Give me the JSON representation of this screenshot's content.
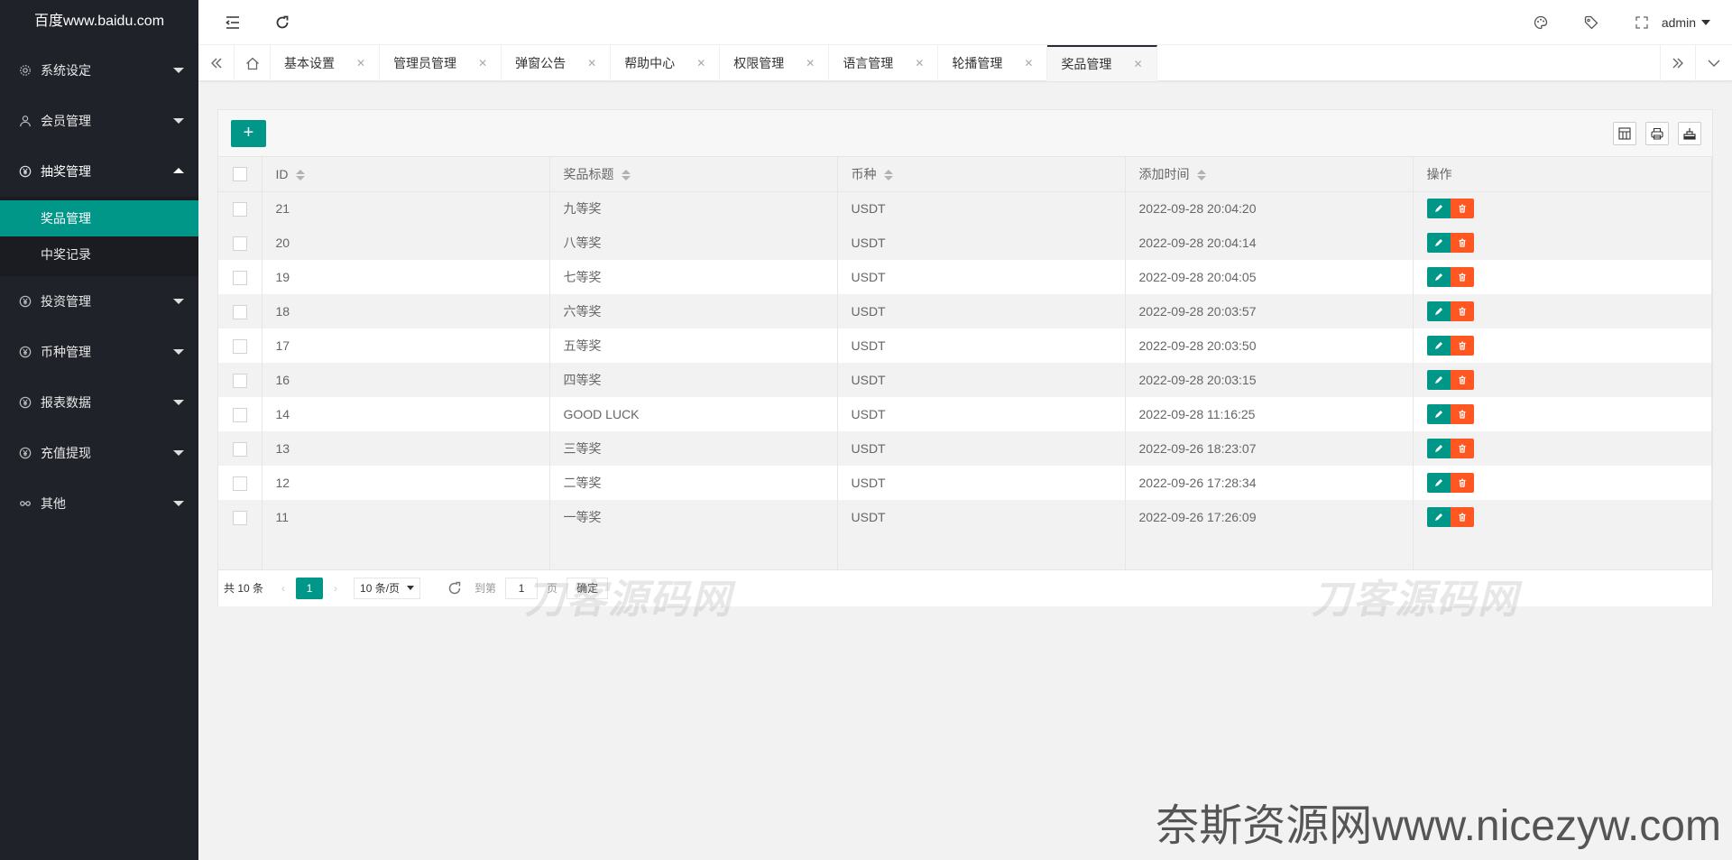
{
  "sidebar": {
    "logo": "百度www.baidu.com",
    "items": [
      {
        "label": "系统设定",
        "icon": "gear-icon"
      },
      {
        "label": "会员管理",
        "icon": "user-icon"
      },
      {
        "label": "抽奖管理",
        "icon": "yen-icon"
      },
      {
        "label": "投资管理",
        "icon": "yen-icon"
      },
      {
        "label": "币种管理",
        "icon": "yen-icon"
      },
      {
        "label": "报表数据",
        "icon": "yen-icon"
      },
      {
        "label": "充值提现",
        "icon": "yen-icon"
      },
      {
        "label": "其他",
        "icon": "link-icon"
      }
    ],
    "sub": [
      "奖品管理",
      "中奖记录"
    ]
  },
  "header": {
    "user": "admin"
  },
  "tabs": [
    "基本设置",
    "管理员管理",
    "弹窗公告",
    "帮助中心",
    "权限管理",
    "语言管理",
    "轮播管理",
    "奖品管理"
  ],
  "table": {
    "columns": [
      "ID",
      "奖品标题",
      "币种",
      "添加时间",
      "操作"
    ],
    "rows": [
      {
        "id": "21",
        "title": "九等奖",
        "coin": "USDT",
        "time": "2022-09-28 20:04:20"
      },
      {
        "id": "20",
        "title": "八等奖",
        "coin": "USDT",
        "time": "2022-09-28 20:04:14"
      },
      {
        "id": "19",
        "title": "七等奖",
        "coin": "USDT",
        "time": "2022-09-28 20:04:05"
      },
      {
        "id": "18",
        "title": "六等奖",
        "coin": "USDT",
        "time": "2022-09-28 20:03:57"
      },
      {
        "id": "17",
        "title": "五等奖",
        "coin": "USDT",
        "time": "2022-09-28 20:03:50"
      },
      {
        "id": "16",
        "title": "四等奖",
        "coin": "USDT",
        "time": "2022-09-28 20:03:15"
      },
      {
        "id": "14",
        "title": "GOOD LUCK",
        "coin": "USDT",
        "time": "2022-09-28 11:16:25"
      },
      {
        "id": "13",
        "title": "三等奖",
        "coin": "USDT",
        "time": "2022-09-26 18:23:07"
      },
      {
        "id": "12",
        "title": "二等奖",
        "coin": "USDT",
        "time": "2022-09-26 17:28:34"
      },
      {
        "id": "11",
        "title": "一等奖",
        "coin": "USDT",
        "time": "2022-09-26 17:26:09"
      }
    ]
  },
  "pager": {
    "total": "共 10 条",
    "current": "1",
    "per_page": "10 条/页",
    "goto": "到第",
    "page_input": "1",
    "page_unit": "页",
    "confirm": "确定"
  },
  "watermarks": [
    "刀客源码网",
    "刀客源码网",
    "奈斯资源网www.nicezyw.com"
  ],
  "colors": {
    "accent": "#009688",
    "danger": "#ff5722",
    "sidebar": "#20222a"
  }
}
